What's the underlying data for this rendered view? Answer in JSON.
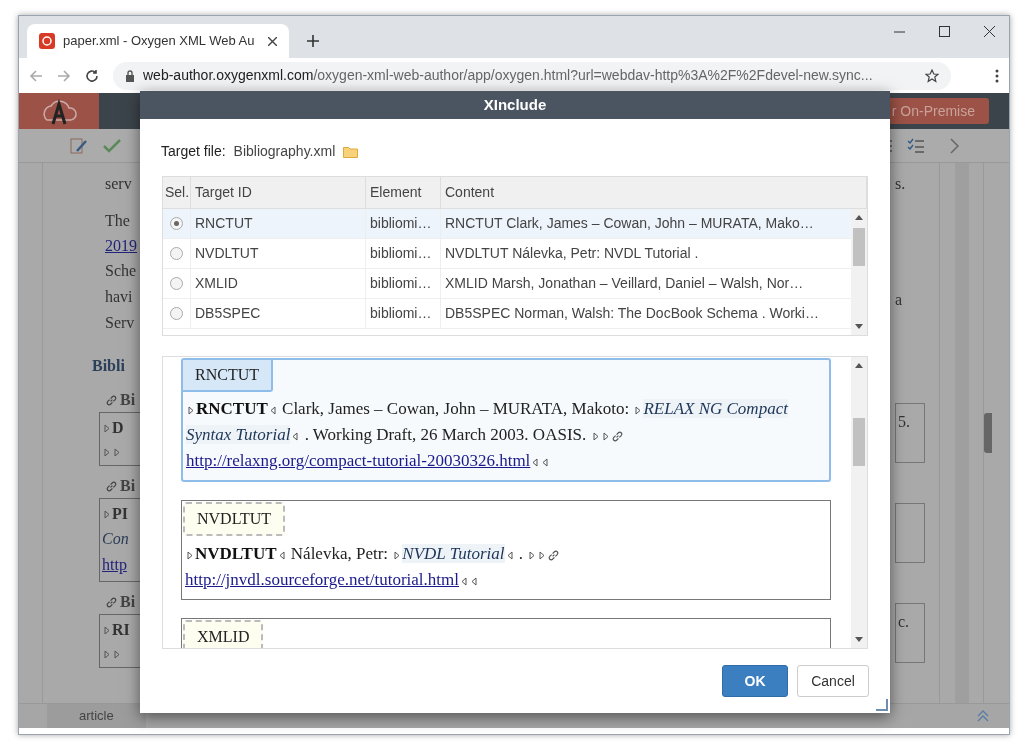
{
  "browser": {
    "tab": {
      "title": "paper.xml - Oxygen XML Web Au"
    },
    "address": {
      "domain": "web-author.oxygenxml.com",
      "path": "/oxygen-xml-web-author/app/oxygen.html?url=webdav-http%3A%2F%2Fdevel-new.sync..."
    }
  },
  "editor": {
    "header_button": "r On-Premise",
    "left_text": [
      {
        "kind": "line",
        "text": "serv"
      },
      {
        "kind": "gap-line",
        "text": "The"
      },
      {
        "kind": "link",
        "text": "2019"
      },
      {
        "kind": "line",
        "text": "Sche"
      },
      {
        "kind": "line",
        "text": "havi"
      },
      {
        "kind": "line",
        "text": "Serv"
      },
      {
        "kind": "heading",
        "text": "Bibli"
      },
      {
        "kind": "entry",
        "title": "Bi",
        "lines": [
          {
            "kind": "bold",
            "text": "D"
          },
          {
            "kind": "markers"
          }
        ]
      },
      {
        "kind": "entry",
        "title": "Bi",
        "lines": [
          {
            "kind": "bold",
            "text": "PI"
          },
          {
            "kind": "italic",
            "text": "Con"
          },
          {
            "kind": "link",
            "text": "http"
          }
        ]
      },
      {
        "kind": "entry",
        "title": "Bi",
        "lines": [
          {
            "kind": "bold",
            "text": "RI"
          },
          {
            "kind": "markers"
          }
        ]
      }
    ],
    "right_text": [
      {
        "kind": "line",
        "text": "s."
      },
      {
        "kind": "line",
        "text": "a"
      },
      {
        "kind": "box",
        "text": "5."
      },
      {
        "kind": "box"
      },
      {
        "kind": "box",
        "text": "c."
      }
    ],
    "status_bar": {
      "tab": "article"
    }
  },
  "dialog": {
    "title": "XInclude",
    "target_file": {
      "label": "Target file:",
      "value": "Bibliography.xml"
    },
    "table": {
      "columns": [
        "Sel.",
        "Target ID",
        "Element",
        "Content"
      ],
      "rows": [
        {
          "selected": true,
          "id": "RNCTUT",
          "element": "bibliomi…",
          "content": "RNCTUT Clark, James – Cowan, John – MURATA, Mako…"
        },
        {
          "selected": false,
          "id": "NVDLTUT",
          "element": "bibliomi…",
          "content": "NVDLTUT Nálevka, Petr: NVDL Tutorial ."
        },
        {
          "selected": false,
          "id": "XMLID",
          "element": "bibliomi…",
          "content": "XMLID Marsh, Jonathan – Veillard, Daniel – Walsh, Nor…"
        },
        {
          "selected": false,
          "id": "DB5SPEC",
          "element": "bibliomi…",
          "content": "DB5SPEC Norman, Walsh: The DocBook Schema . Worki…"
        }
      ]
    },
    "preview": {
      "cards": [
        {
          "selected": true,
          "label": "RNCTUT",
          "segments": [
            {
              "kind": "tag-open"
            },
            {
              "kind": "bold",
              "text": "RNCTUT"
            },
            {
              "kind": "tag-close"
            },
            {
              "kind": "text",
              "text": " Clark, James – Cowan, John – MURATA, Makoto: "
            },
            {
              "kind": "tag-open"
            },
            {
              "kind": "italic",
              "text": "RELAX NG Compact Syntax Tutorial"
            },
            {
              "kind": "tag-close"
            },
            {
              "kind": "text",
              "text": " . Working Draft, 26 March 2003. OASIS. "
            },
            {
              "kind": "tag-open"
            },
            {
              "kind": "tag-open"
            },
            {
              "kind": "link-icon"
            },
            {
              "kind": "link",
              "text": "http://relaxng.org/compact-tutorial-20030326.html"
            },
            {
              "kind": "tag-close"
            },
            {
              "kind": "tag-close"
            }
          ]
        },
        {
          "selected": false,
          "label": "NVDLTUT",
          "segments": [
            {
              "kind": "tag-open"
            },
            {
              "kind": "bold",
              "text": "NVDLTUT"
            },
            {
              "kind": "tag-close"
            },
            {
              "kind": "text",
              "text": " Nálevka, Petr: "
            },
            {
              "kind": "tag-open"
            },
            {
              "kind": "italic",
              "text": "NVDL Tutorial"
            },
            {
              "kind": "tag-close"
            },
            {
              "kind": "text",
              "text": " . "
            },
            {
              "kind": "tag-open"
            },
            {
              "kind": "tag-open"
            },
            {
              "kind": "link-icon"
            },
            {
              "kind": "link",
              "text": "http://jnvdl.sourceforge.net/tutorial.html"
            },
            {
              "kind": "tag-close"
            },
            {
              "kind": "tag-close"
            }
          ]
        },
        {
          "selected": false,
          "label": "XMLID"
        }
      ]
    },
    "buttons": [
      {
        "kind": "primary",
        "label": "OK"
      },
      {
        "kind": "secondary",
        "label": "Cancel"
      }
    ]
  }
}
